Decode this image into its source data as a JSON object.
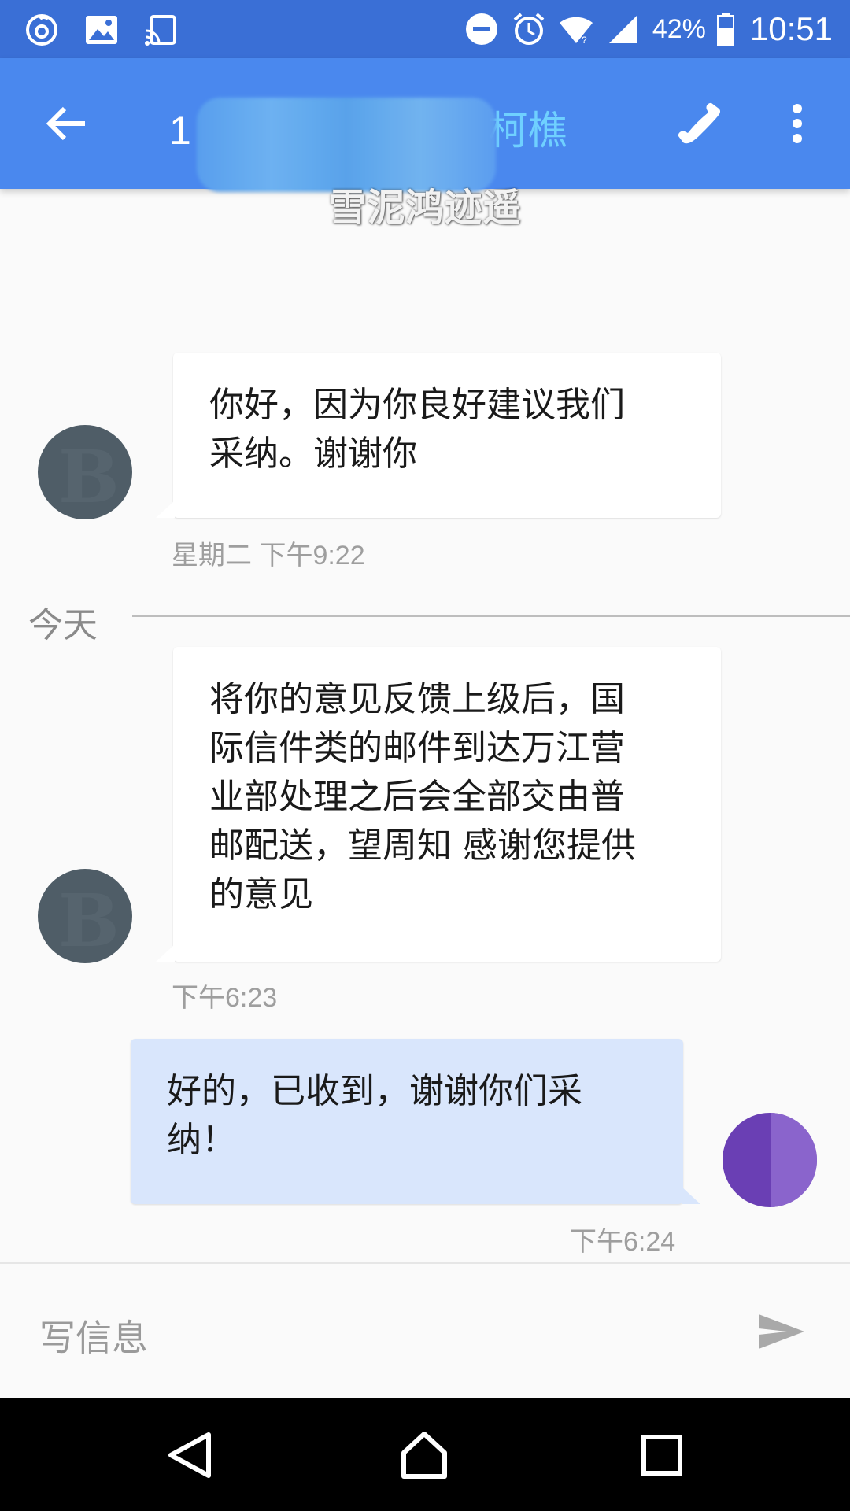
{
  "status_bar": {
    "battery_percent": "42%",
    "time": "10:51",
    "left_icons": [
      "netease-music-icon",
      "image-icon",
      "cast-icon"
    ],
    "right_icons": [
      "do-not-disturb-icon",
      "alarm-icon",
      "wifi-icon",
      "signal-icon",
      "battery-icon"
    ]
  },
  "toolbar": {
    "contact_name_prefix": "1",
    "contact_name_suffix": "柯樵",
    "icons": [
      "back-arrow-icon",
      "phone-icon",
      "more-vert-icon"
    ]
  },
  "watermark": "雪泥鸿迹遥",
  "messages": [
    {
      "direction": "incoming",
      "text_lines": [
        "你好，因为你良好建议我们",
        "采纳。谢谢你"
      ],
      "timestamp": "星期二 下午9:22"
    },
    {
      "direction": "incoming",
      "text_lines": [
        "将你的意见反馈上级后，国",
        "际信件类的邮件到达万江营",
        "业部处理之后会全部交由普",
        "邮配送，望周知 感谢您提供",
        "的意见"
      ],
      "timestamp": "下午6:23"
    },
    {
      "direction": "outgoing",
      "text_lines": [
        "好的，已收到，谢谢你们采",
        "纳！"
      ],
      "timestamp": "下午6:24"
    }
  ],
  "day_divider": "今天",
  "compose": {
    "placeholder": "写信息"
  },
  "colors": {
    "status_bar": "#3a6fd6",
    "toolbar": "#4a88ee",
    "outgoing_bubble": "#d9e6fc",
    "incoming_bubble": "#ffffff"
  }
}
